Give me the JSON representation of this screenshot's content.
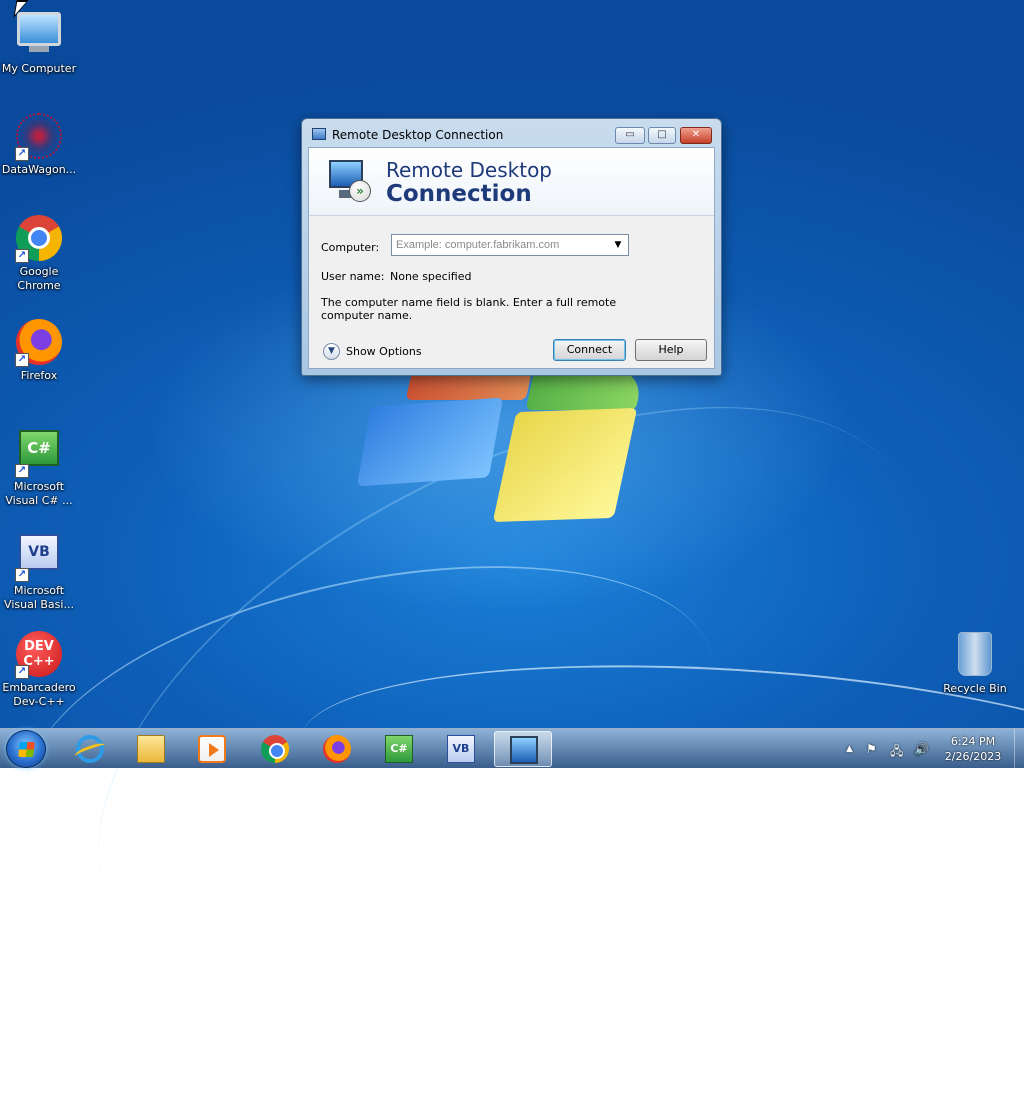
{
  "desktop": {
    "icons": [
      {
        "label": "My Computer",
        "icon": "computer-icon"
      },
      {
        "label": "DataWagon...",
        "icon": "datawagon-icon"
      },
      {
        "label": "Google Chrome",
        "icon": "chrome-icon"
      },
      {
        "label": "Firefox",
        "icon": "firefox-icon"
      },
      {
        "label": "Microsoft Visual C# ...",
        "icon": "visual-csharp-icon",
        "glyph": "C#"
      },
      {
        "label": "Microsoft Visual Basi...",
        "icon": "visual-basic-icon",
        "glyph": "VB"
      },
      {
        "label": "Embarcadero Dev-C++",
        "icon": "dev-cpp-icon",
        "glyph": "DEV\nC++"
      },
      {
        "label": "Recycle Bin",
        "icon": "recycle-bin-icon"
      }
    ]
  },
  "dialog": {
    "title": "Remote Desktop Connection",
    "banner_line1": "Remote Desktop",
    "banner_line2": "Connection",
    "computer_label": "Computer:",
    "computer_value": "",
    "computer_placeholder": "Example: computer.fabrikam.com",
    "username_label": "User name:",
    "username_value": "None specified",
    "message": "The computer name field is blank. Enter a full remote computer name.",
    "show_options": "Show Options",
    "connect": "Connect",
    "help": "Help",
    "controls": {
      "minimize": "▭",
      "maximize": "□",
      "close": "✕"
    }
  },
  "taskbar": {
    "pinned": [
      {
        "name": "internet-explorer-icon"
      },
      {
        "name": "windows-explorer-icon"
      },
      {
        "name": "media-player-icon"
      },
      {
        "name": "chrome-icon"
      },
      {
        "name": "firefox-icon"
      },
      {
        "name": "visual-csharp-icon",
        "glyph": "C#"
      },
      {
        "name": "visual-basic-icon",
        "glyph": "VB"
      },
      {
        "name": "remote-desktop-icon",
        "active": true
      }
    ],
    "tray": {
      "chevron": "▲",
      "flag": "⚑",
      "network": "🖧",
      "volume": "🔊"
    },
    "time": "6:24 PM",
    "date": "2/26/2023"
  },
  "colors": {
    "desktop_blue": "#0e5fb8",
    "dialog_frame": "#a9c6e3",
    "banner_text": "#1e3a7a"
  }
}
